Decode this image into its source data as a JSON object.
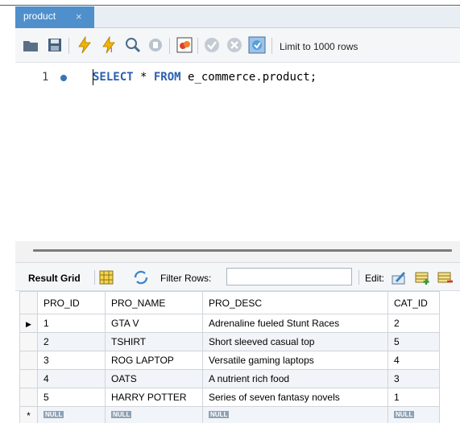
{
  "tab": {
    "label": "product",
    "close_label": "×"
  },
  "toolbar": {
    "limit_label": "Limit to 1000 rows"
  },
  "editor": {
    "line_number": "1",
    "keyword_select": "SELECT",
    "star": " * ",
    "keyword_from": "FROM",
    "table": " e_commerce.product;"
  },
  "result": {
    "grid_label": "Result Grid",
    "filter_label": "Filter Rows:",
    "filter_value": "",
    "edit_label": "Edit:",
    "columns": [
      "PRO_ID",
      "PRO_NAME",
      "PRO_DESC",
      "CAT_ID"
    ],
    "rows": [
      [
        "1",
        "GTA V",
        "Adrenaline fueled Stunt Races",
        "2"
      ],
      [
        "2",
        "TSHIRT",
        "Short sleeved casual top",
        "5"
      ],
      [
        "3",
        "ROG LAPTOP",
        "Versatile gaming laptops",
        "4"
      ],
      [
        "4",
        "OATS",
        "A nutrient rich food",
        "3"
      ],
      [
        "5",
        "HARRY POTTER",
        "Series of seven fantasy novels",
        "1"
      ]
    ],
    "null_label": "NULL",
    "current_row_marker": "▶",
    "new_row_marker": "*"
  },
  "colors": {
    "tab_bg": "#4f8fcc",
    "keyword": "#2b5fb0",
    "null_badge": "#8ea2b5"
  }
}
